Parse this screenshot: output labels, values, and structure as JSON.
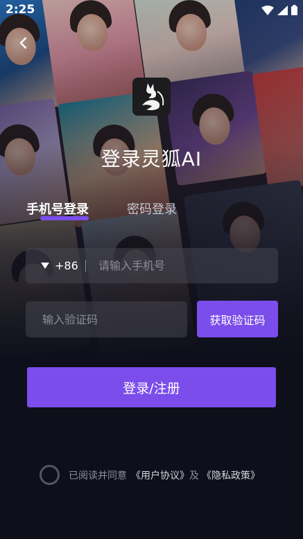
{
  "status_bar": {
    "time": "2:25",
    "icons": [
      "wifi-icon",
      "cellular-icon",
      "battery-icon"
    ]
  },
  "header": {
    "back_icon": "chevron-left-icon",
    "title": "登录灵狐AI"
  },
  "tabs": [
    {
      "label": "手机号登录",
      "active": true
    },
    {
      "label": "密码登录",
      "active": false
    }
  ],
  "phone": {
    "country_code": "+86",
    "placeholder": "请输入手机号"
  },
  "code": {
    "placeholder": "输入验证码",
    "button_label": "获取验证码"
  },
  "login_button": "登录/注册",
  "agreement": {
    "prefix": "已阅读并同意",
    "user_agreement": "《用户协议》",
    "conjunction": "及",
    "privacy_policy": "《隐私政策》",
    "checked": false
  },
  "colors": {
    "accent": "#7b4dea",
    "background": "#0d0f1a"
  }
}
